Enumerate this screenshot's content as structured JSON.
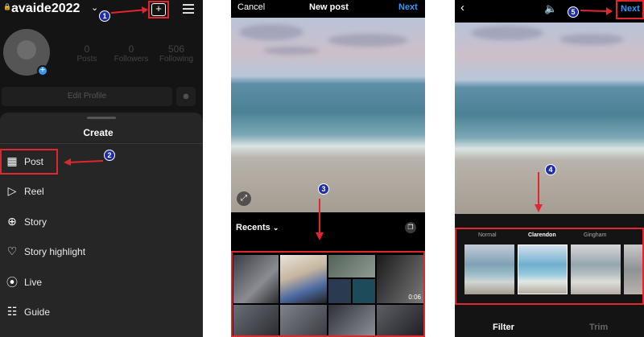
{
  "profile": {
    "username": "avaide2022",
    "stats": [
      {
        "count": "0",
        "label": "Posts"
      },
      {
        "count": "0",
        "label": "Followers"
      },
      {
        "count": "506",
        "label": "Following"
      }
    ],
    "edit_label": "Edit Profile"
  },
  "create_sheet": {
    "title": "Create",
    "items": [
      {
        "label": "Post",
        "icon": "grid-icon"
      },
      {
        "label": "Reel",
        "icon": "reel-icon"
      },
      {
        "label": "Story",
        "icon": "story-icon"
      },
      {
        "label": "Story highlight",
        "icon": "heart-circle-icon"
      },
      {
        "label": "Live",
        "icon": "live-icon"
      },
      {
        "label": "Guide",
        "icon": "guide-icon"
      }
    ]
  },
  "new_post": {
    "cancel": "Cancel",
    "title": "New post",
    "next": "Next",
    "recents": "Recents",
    "video_duration": "0:06"
  },
  "editor": {
    "next": "Next",
    "filters": [
      "Normal",
      "Clarendon",
      "Gingham"
    ],
    "selected_filter": "Clarendon",
    "tabs": [
      "Filter",
      "Trim"
    ]
  },
  "steps": [
    "1",
    "2",
    "3",
    "4",
    "5"
  ],
  "colors": {
    "annotation": "#e1262d",
    "accent": "#3897f0",
    "badge": "#1f2ea6"
  }
}
